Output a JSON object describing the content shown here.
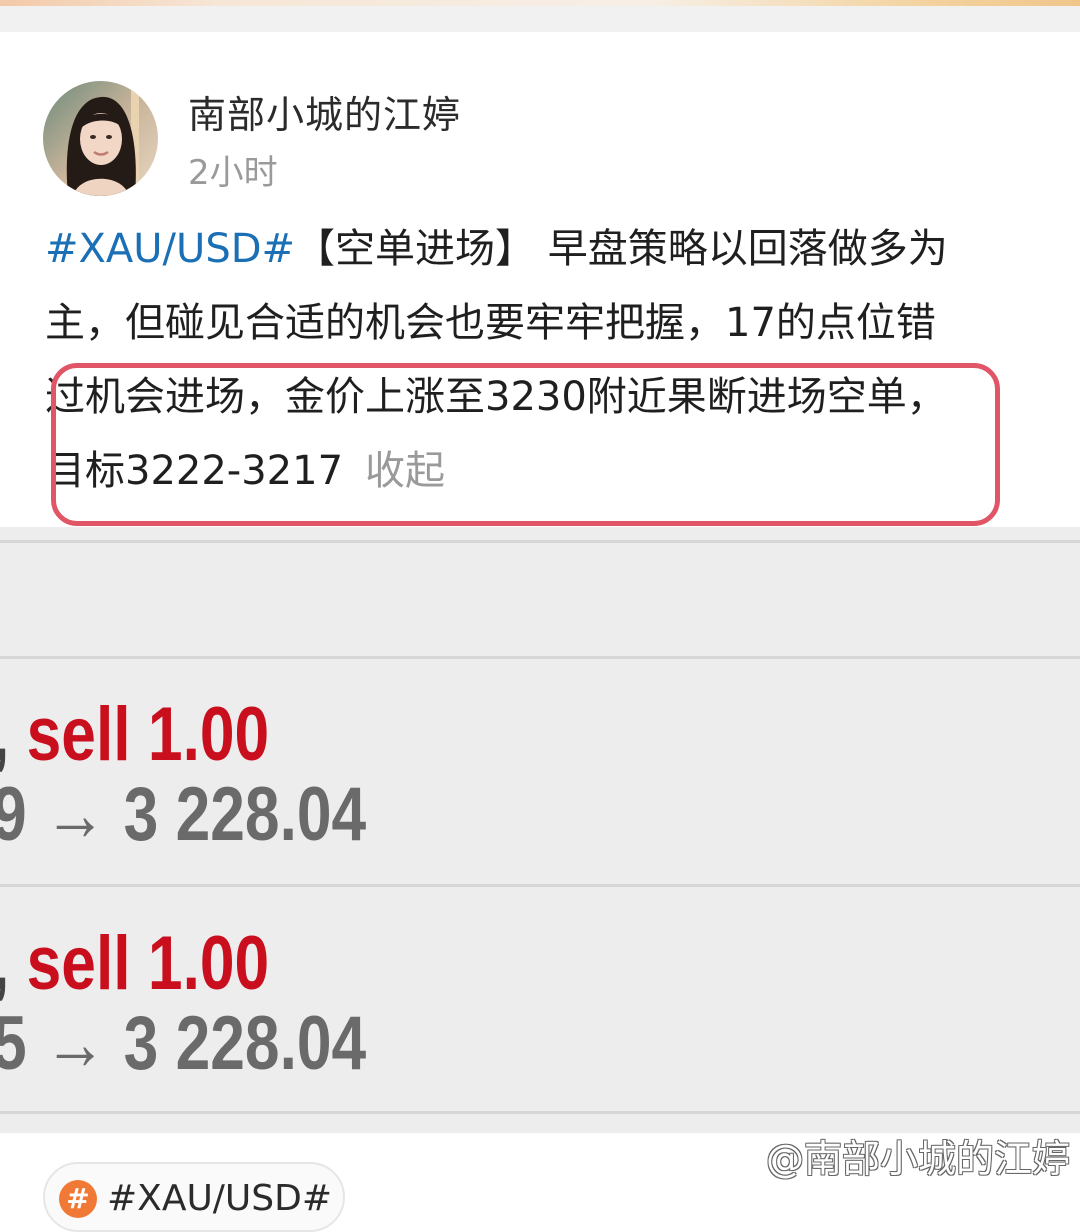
{
  "post": {
    "author": "南部小城的江婷",
    "time": "2小时",
    "text": {
      "hashtag": "#XAU/USD#",
      "line1_rest": "【空单进场】 早盘策略以回落做多为",
      "line2": "主，但碰见合适的机会也要牢牢把握，17的点位错",
      "line3": "过机会进场，金价上涨至3230附近果断进场空单，",
      "line4": "目标3222-3217",
      "collapse_label": "收起"
    }
  },
  "trades": [
    {
      "prefix": ",",
      "action": "sell 1.00",
      "prev_digit": "9",
      "arrow": "→",
      "price": "3 228.04"
    },
    {
      "prefix": ",",
      "action": "sell 1.00",
      "prev_digit": "5",
      "arrow": "→",
      "price": "3 228.04"
    }
  ],
  "watermark": "@南部小城的江婷",
  "topic_tag": {
    "icon": "hashtag-icon",
    "label": "#XAU/USD#"
  },
  "colors": {
    "hashtag": "#1b6fb5",
    "highlight_border": "#e05667",
    "sell_red": "#c90f1e",
    "tag_icon": "#f07a35"
  }
}
